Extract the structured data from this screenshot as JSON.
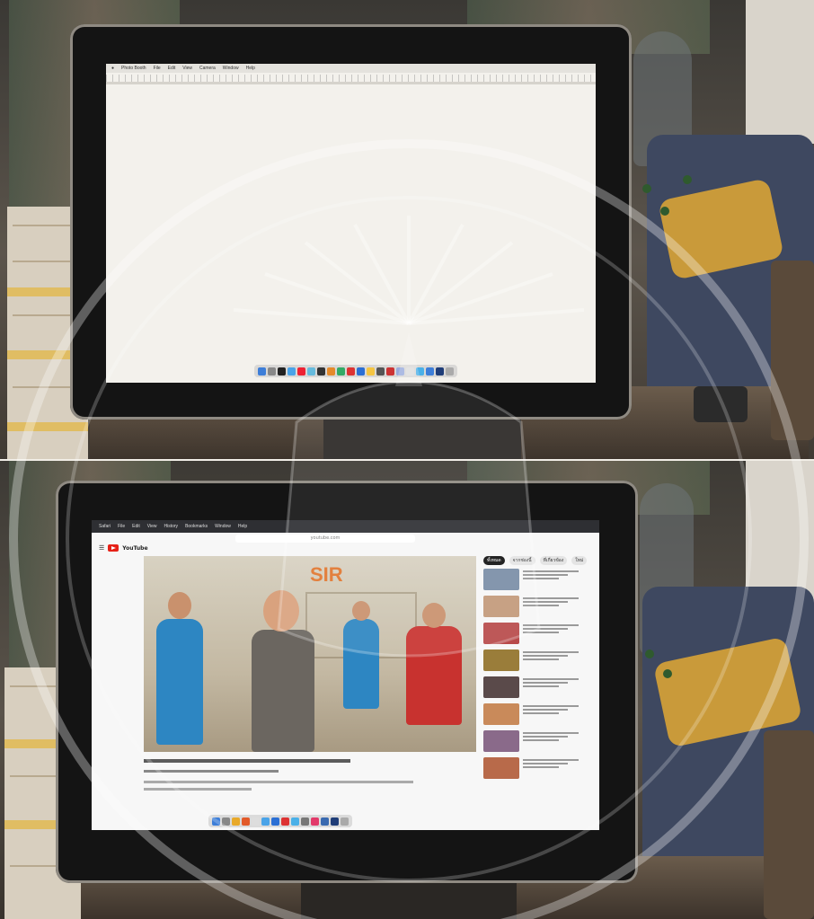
{
  "top_screen": {
    "menubar": [
      "Photo Booth",
      "File",
      "Edit",
      "View",
      "Camera",
      "Window",
      "Help"
    ]
  },
  "bottom_screen": {
    "browser_menubar": [
      "Safari",
      "File",
      "Edit",
      "View",
      "History",
      "Bookmarks",
      "Window",
      "Help"
    ],
    "address_text": "youtube.com",
    "brand": "YouTube",
    "video_overlay_text": "SIR",
    "chips": [
      "ทั้งหมด",
      "จากช่องนี้",
      "ที่เกี่ยวข้อง",
      "ใหม่"
    ]
  },
  "watermark": {
    "type": "university seal",
    "color": "#ffffff"
  }
}
